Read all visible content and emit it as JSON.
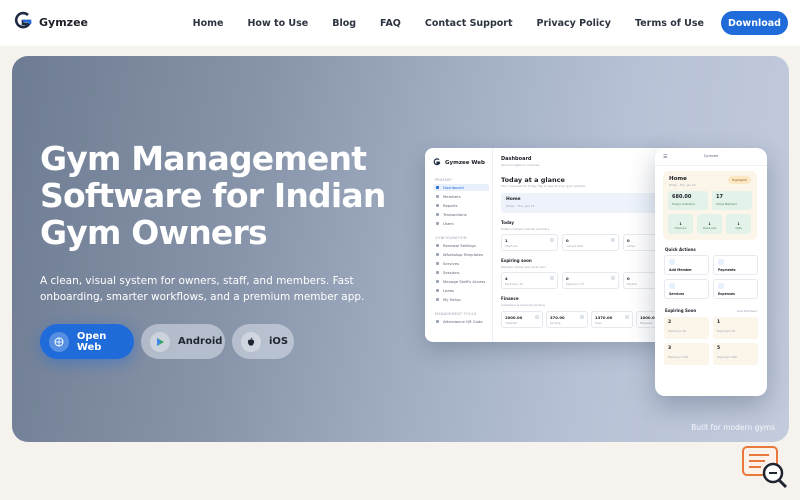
{
  "nav": {
    "brand": "Gymzee",
    "logo_caption": "Gymzee",
    "links": [
      "Home",
      "How to Use",
      "Blog",
      "FAQ",
      "Contact Support",
      "Privacy Policy",
      "Terms of Use"
    ],
    "download": "Download"
  },
  "hero": {
    "title": "Gym Management Software for Indian Gym Owners",
    "subtitle": "A clean, visual system for owners, staff, and members. Fast onboarding, smarter workflows, and a premium member app.",
    "buttons": {
      "web": "Open Web",
      "android": "Android",
      "ios": "iOS"
    },
    "built_note": "Built for modern gyms"
  },
  "desktop_app": {
    "brand": "Gymzee Web",
    "sections": [
      "PRIMARY",
      "CONFIGURATION",
      "MANAGEMENT TOOLS"
    ],
    "sidebar": [
      "Dashboard",
      "Members",
      "Reports",
      "Transactions",
      "Users",
      "Renewal Settings",
      "WhatsApp Templates",
      "Services",
      "Sessions",
      "Manage Staff's Access",
      "Leads",
      "My Setup",
      "Attendance QR Code"
    ],
    "header": {
      "title": "Dashboard",
      "subtitle": "Quick insights to improve"
    },
    "heading": "Today at a glance",
    "heading_note": "Your overview for today. Tap to see all your gym activity.",
    "home": {
      "title": "Home",
      "subtitle": "Today · Thu, Jan 15"
    },
    "today": {
      "label": "Today",
      "note": "Today's member activity summary",
      "cards": [
        {
          "value": "1",
          "label": "Check-ins"
        },
        {
          "value": "0",
          "label": "Current Visits"
        },
        {
          "value": "0",
          "label": "Active"
        }
      ]
    },
    "expiring": {
      "label": "Expiring soon",
      "note": "Members whose plan ends soon",
      "cards": [
        {
          "value": "4",
          "label": "Expiring in 3d"
        },
        {
          "value": "0",
          "label": "Expiring in 7d"
        },
        {
          "value": "0",
          "label": "Expired"
        }
      ]
    },
    "finance": {
      "label": "Finance",
      "note": "Collections & amounts pending",
      "cards": [
        {
          "value": "2000.00",
          "label": "Collected"
        },
        {
          "value": "370.00",
          "label": "Pending"
        },
        {
          "value": "1370.00",
          "label": "Dues"
        },
        {
          "value": "1000.00",
          "label": "Expenses"
        }
      ]
    }
  },
  "mobile_app": {
    "header": "Gymzee",
    "home": {
      "title": "Home",
      "subtitle": "Today · Thu, Jan 15",
      "badge": "Highlights"
    },
    "stats": [
      {
        "value": "680.00",
        "label": "Today's Collection"
      },
      {
        "value": "17",
        "label": "Active Members"
      }
    ],
    "tiles": [
      {
        "value": "1",
        "label": "Check-ins"
      },
      {
        "value": "1",
        "label": "Check-outs"
      },
      {
        "value": "1",
        "label": "Visits"
      }
    ],
    "quick_actions_label": "Quick Actions",
    "quick_actions": [
      "Add Member",
      "Payments",
      "Services",
      "Expenses"
    ],
    "expiring_label": "Expiring Soon",
    "expiring_link": "View Members",
    "expiring": [
      {
        "value": "2",
        "label": "Expiring in 3D"
      },
      {
        "value": "1",
        "label": "Expiring in 7D"
      },
      {
        "value": "3",
        "label": "Expiring in 15D"
      },
      {
        "value": "5",
        "label": "Expiring in 30D"
      }
    ]
  },
  "colors": {
    "accent": "#1f6bd9",
    "hero_start": "#6e7c93",
    "hero_end": "#c3cbdd",
    "background": "#f6f3ee"
  },
  "icons": {
    "web": "globe-icon",
    "android": "play-store-icon",
    "ios": "apple-icon",
    "widget": "chat-search-icon"
  }
}
